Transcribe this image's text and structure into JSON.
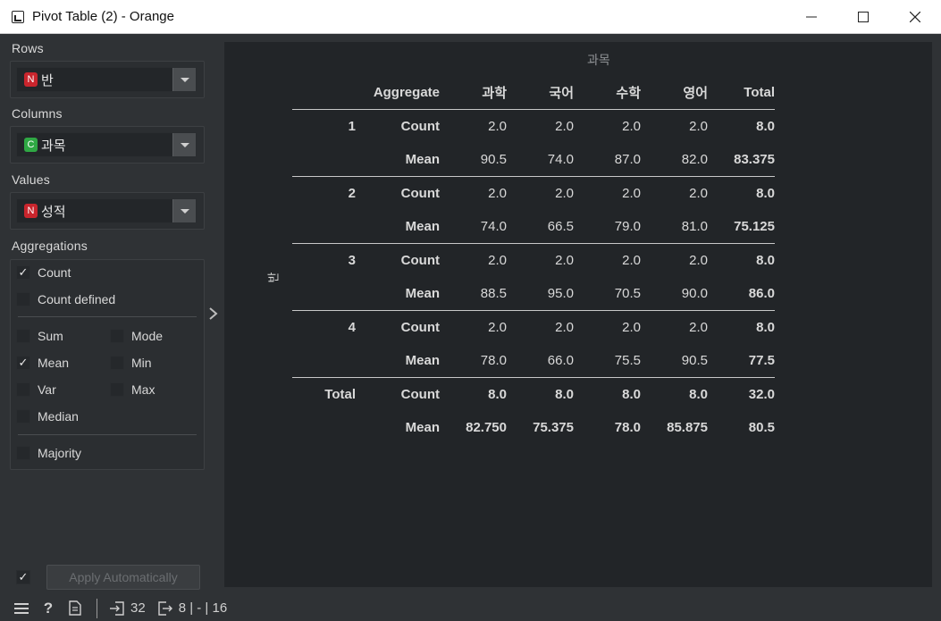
{
  "window": {
    "title": "Pivot Table (2) - Orange"
  },
  "left": {
    "rows_label": "Rows",
    "rows_badge": "N",
    "rows_value": "반",
    "columns_label": "Columns",
    "columns_badge": "C",
    "columns_value": "과목",
    "values_label": "Values",
    "values_badge": "N",
    "values_value": "성적",
    "aggregations_label": "Aggregations",
    "checks": {
      "count": "Count",
      "count_defined": "Count defined",
      "sum": "Sum",
      "mode": "Mode",
      "mean": "Mean",
      "min": "Min",
      "var": "Var",
      "max": "Max",
      "median": "Median",
      "majority": "Majority"
    },
    "checked": [
      "count",
      "mean"
    ],
    "apply_label": "Apply Automatically"
  },
  "table": {
    "column_var": "과목",
    "row_var": "반",
    "header": [
      "Aggregate",
      "과학",
      "국어",
      "수학",
      "영어",
      "Total"
    ],
    "groups": [
      {
        "row": "1",
        "count": [
          "2.0",
          "2.0",
          "2.0",
          "2.0",
          "8.0"
        ],
        "mean": [
          "90.5",
          "74.0",
          "87.0",
          "82.0",
          "83.375"
        ]
      },
      {
        "row": "2",
        "count": [
          "2.0",
          "2.0",
          "2.0",
          "2.0",
          "8.0"
        ],
        "mean": [
          "74.0",
          "66.5",
          "79.0",
          "81.0",
          "75.125"
        ]
      },
      {
        "row": "3",
        "count": [
          "2.0",
          "2.0",
          "2.0",
          "2.0",
          "8.0"
        ],
        "mean": [
          "88.5",
          "95.0",
          "70.5",
          "90.0",
          "86.0"
        ]
      },
      {
        "row": "4",
        "count": [
          "2.0",
          "2.0",
          "2.0",
          "2.0",
          "8.0"
        ],
        "mean": [
          "78.0",
          "66.0",
          "75.5",
          "90.5",
          "77.5"
        ]
      },
      {
        "row": "Total",
        "count": [
          "8.0",
          "8.0",
          "8.0",
          "8.0",
          "32.0"
        ],
        "mean": [
          "82.750",
          "75.375",
          "78.0",
          "85.875",
          "80.5"
        ]
      }
    ],
    "count_label": "Count",
    "mean_label": "Mean"
  },
  "status": {
    "input_count": "32",
    "output_text": "8 | - | 16"
  }
}
